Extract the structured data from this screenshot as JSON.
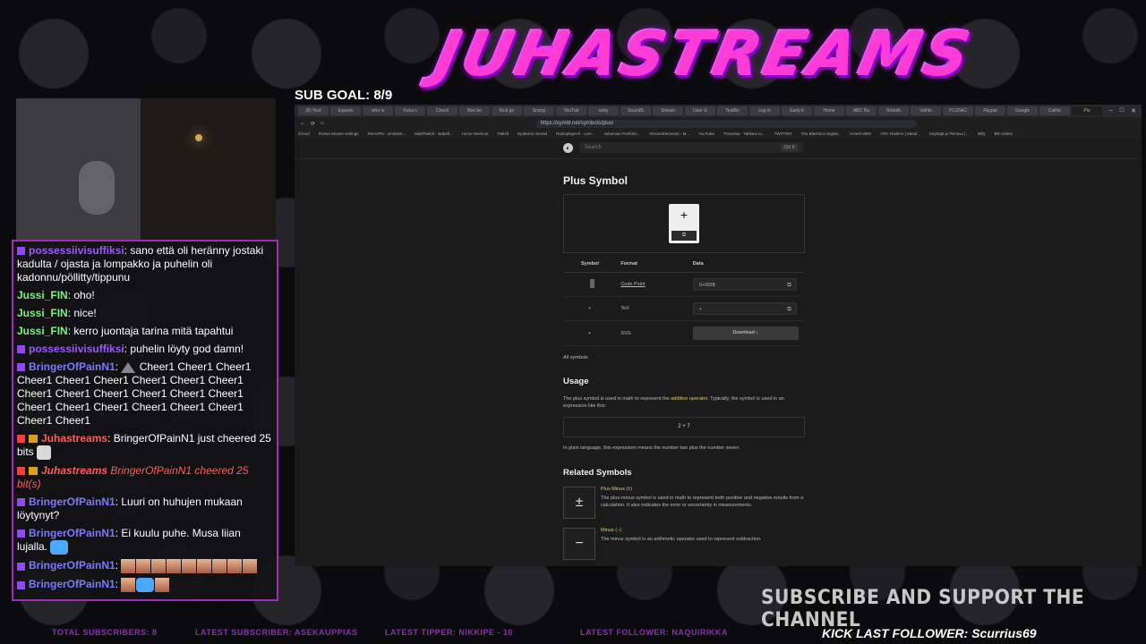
{
  "overlay": {
    "logo_text": "JUHASTREAMS",
    "sub_goal": "SUB GOAL: 8/9",
    "support_text": "SUBSCRIBE AND SUPPORT THE CHANNEL",
    "total_subscribers": "TOTAL SUBSCRIBERS: 8",
    "latest_subscriber": "LATEST SUBSCRIBER: ASEKAUPPIAS",
    "latest_tipper": "LATEST TIPPER: NIKKIPE - 10",
    "latest_follower": "LATEST FOLLOWER: NAQUIRIKKA",
    "kick_follower": "KICK LAST FOLLOWER: Scurrius69",
    "accent_color": "#ff3bd6"
  },
  "chat": {
    "messages": [
      {
        "user": "possessiivisuffiksi",
        "user_color": "purple",
        "text": "sano että oli heränny jostaki kadulta / ojasta ja lompakko ja puhelin oli kadonnu/pöllitty/tippunu"
      },
      {
        "user": "Jussi_FIN",
        "user_color": "green",
        "text": "oho!"
      },
      {
        "user": "Jussi_FIN",
        "user_color": "green",
        "text": "nice!"
      },
      {
        "user": "Jussi_FIN",
        "user_color": "green",
        "text": "kerro juontaja tarina mitä tapahtui"
      },
      {
        "user": "possessiivisuffiksi",
        "user_color": "purple",
        "text": "puhelin löyty god damn!"
      },
      {
        "user": "BringerOfPainN1",
        "user_color": "blue",
        "text": "Cheer1 Cheer1 Cheer1 Cheer1 Cheer1 Cheer1 Cheer1 Cheer1 Cheer1 Cheer1 Cheer1 Cheer1 Cheer1 Cheer1 Cheer1 Cheer1 Cheer1 Cheer1 Cheer1 Cheer1 Cheer1 Cheer1 Cheer1"
      },
      {
        "user": "Juhastreams",
        "user_color": "red",
        "text": "BringerOfPainN1 just cheered 25 bits"
      },
      {
        "user": "Juhastreams",
        "user_color": "red",
        "text": "BringerOfPainN1 cheered 25 bit(s)"
      },
      {
        "user": "BringerOfPainN1",
        "user_color": "blue",
        "text": "Luuri on huhujen mukaan löytynyt?"
      },
      {
        "user": "BringerOfPainN1",
        "user_color": "blue",
        "text": "Ei kuulu puhe. Musa liian lujalla."
      },
      {
        "user": "BringerOfPainN1",
        "user_color": "blue",
        "text": ""
      },
      {
        "user": "BringerOfPainN1",
        "user_color": "blue",
        "text": ""
      }
    ]
  },
  "browser": {
    "tabs": [
      "(8) Yout",
      "Esports",
      "who is",
      "Kuka v",
      "Check",
      "Bee bo",
      "Kick go",
      "Snoop",
      "YouTub",
      "noity",
      "SoundS",
      "Stream",
      "User G",
      "TextBo",
      "Log in",
      "Early tt",
      "Home",
      "ABC Ra",
      "Roboth",
      "Vaihto",
      "PLG5AC",
      "Paypal",
      "Google",
      "Califor",
      "Plu"
    ],
    "url": "https://symbl.net/symbols/plus/",
    "bookmarks": [
      "iCloud",
      "Rohan Mouse settings",
      "RemoPlo - Unlimite...",
      "MultiTwitch - Babell...",
      "Home Workout",
      "Twitch",
      "Epidemic Sound",
      "Radioplayer.fi - Live...",
      "Juhamian Portfolio...",
      "StreamElements - M...",
      "YouTube",
      "TVuutisia - Tahkasi ru...",
      "TWITTER",
      "The Blackbox Digital...",
      "lo-tech BBS",
      "ARC Raiders | Metaf...",
      "Käyttäjä ja Temsuu |...",
      "Billy",
      "BR Online"
    ],
    "search_placeholder": "Search",
    "search_kbd": "Ctrl K"
  },
  "page": {
    "title": "Plus Symbol",
    "preview_symbol": "+",
    "table_headers": [
      "Symbol",
      "Format",
      "Data"
    ],
    "rows": [
      {
        "format": "Code Point",
        "data": "U+002B"
      },
      {
        "symbol": "+",
        "format": "TeX",
        "data": "+"
      },
      {
        "symbol": "+",
        "format": "SVG",
        "data": "Download ↓"
      }
    ],
    "all_symbols": "All symbols",
    "usage_title": "Usage",
    "usage_text_1": "The plus symbol is used in math to represent the ",
    "usage_link": "addition operator",
    "usage_text_2": ". Typically, the symbol is used in an expression like this:",
    "expression": "2 + 7",
    "plain_language": "In plain language, this expression means the number two plus the number seven.",
    "related_title": "Related Symbols",
    "related": [
      {
        "symbol": "±",
        "name": "Plus Minus (±)",
        "desc": "The plus-minus symbol is used in math to represent both positive and negative results from a calculation. It also indicates the error or uncertainty in measurements."
      },
      {
        "symbol": "−",
        "name": "Minus (−)",
        "desc": "The minus symbol is an arithmetic operator used to represent subtraction."
      }
    ]
  }
}
